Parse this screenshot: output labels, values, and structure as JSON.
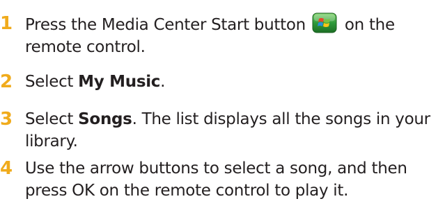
{
  "steps": [
    {
      "number": "1",
      "line1_before": "Press the Media Center Start button",
      "line1_after": "on the",
      "line2": "remote control."
    },
    {
      "number": "2",
      "before": "Select ",
      "bold": "My Music",
      "after": "."
    },
    {
      "number": "3",
      "before": "Select ",
      "bold": "Songs",
      "after": ". The list displays all the songs in your",
      "line2": "library."
    },
    {
      "number": "4",
      "line1": "Use the arrow buttons to select a song, and then",
      "line2": "press OK on the remote control to play it."
    }
  ],
  "colors": {
    "step_number": "#f0ab1c",
    "text": "#231f20",
    "icon_background": "#2e9a3a"
  },
  "icons": {
    "start_button": "media-center-start-icon"
  }
}
